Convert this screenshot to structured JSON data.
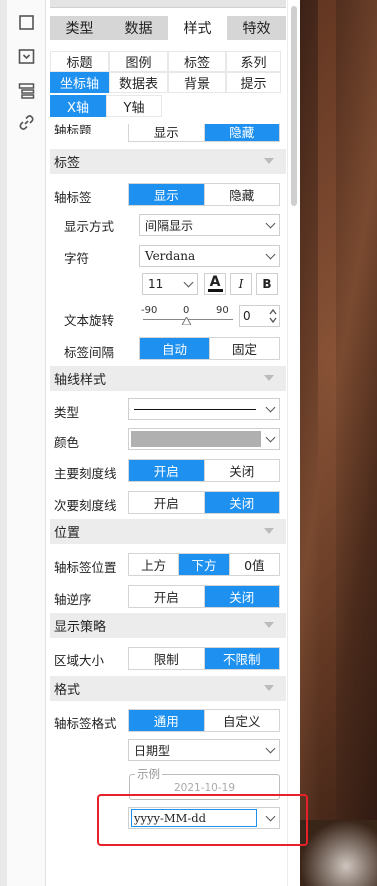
{
  "panel": {
    "tabs": [
      {
        "label": "类型",
        "active": false
      },
      {
        "label": "数据",
        "active": false
      },
      {
        "label": "样式",
        "active": true
      },
      {
        "label": "特效",
        "active": false
      }
    ],
    "subtabs_row1": [
      "标题",
      "图例",
      "标签",
      "系列"
    ],
    "subtabs_row2": [
      "坐标轴",
      "数据表",
      "背景",
      "提示"
    ],
    "active_subtab": "坐标轴",
    "axis_tabs": [
      "X轴",
      "Y轴"
    ],
    "active_axis": "X轴"
  },
  "partial_row": {
    "label": "轴标题",
    "options": [
      "显示",
      "隐藏"
    ],
    "selected": "隐藏"
  },
  "sections": {
    "label": "标签",
    "axis_style": "轴线样式",
    "position": "位置",
    "display_strategy": "显示策略",
    "format": "格式"
  },
  "label_section": {
    "axis_label": {
      "label": "轴标签",
      "options": [
        "显示",
        "隐藏"
      ],
      "selected": "显示"
    },
    "display_mode": {
      "label": "显示方式",
      "value": "间隔显示"
    },
    "font": {
      "label": "字符",
      "value": "Verdana",
      "size": "11",
      "buttons": [
        "A",
        "I",
        "B"
      ]
    },
    "rotation": {
      "label": "文本旋转",
      "scale": [
        "-90",
        "0",
        "90"
      ],
      "value": "0"
    },
    "interval": {
      "label": "标签间隔",
      "options": [
        "自动",
        "固定"
      ],
      "selected": "自动"
    }
  },
  "axis_style_section": {
    "type": {
      "label": "类型"
    },
    "color": {
      "label": "颜色",
      "value": "#b0b0b0"
    },
    "major_tick": {
      "label": "主要刻度线",
      "options": [
        "开启",
        "关闭"
      ],
      "selected": "开启"
    },
    "minor_tick": {
      "label": "次要刻度线",
      "options": [
        "开启",
        "关闭"
      ],
      "selected": "关闭"
    }
  },
  "position_section": {
    "label_position": {
      "label": "轴标签位置",
      "options": [
        "上方",
        "下方",
        "0值"
      ],
      "selected": "下方"
    },
    "reverse": {
      "label": "轴逆序",
      "options": [
        "开启",
        "关闭"
      ],
      "selected": "关闭"
    }
  },
  "strategy_section": {
    "area_size": {
      "label": "区域大小",
      "options": [
        "限制",
        "不限制"
      ],
      "selected": "不限制"
    }
  },
  "format_section": {
    "label_format": {
      "label": "轴标签格式",
      "options": [
        "通用",
        "自定义"
      ],
      "selected": "通用"
    },
    "format_type": "日期型",
    "example_legend": "示例",
    "example_value": "2021-10-19",
    "pattern": "yyyy-MM-dd"
  },
  "colors": {
    "accent": "#1e90f0",
    "highlight": "#e8202a"
  }
}
